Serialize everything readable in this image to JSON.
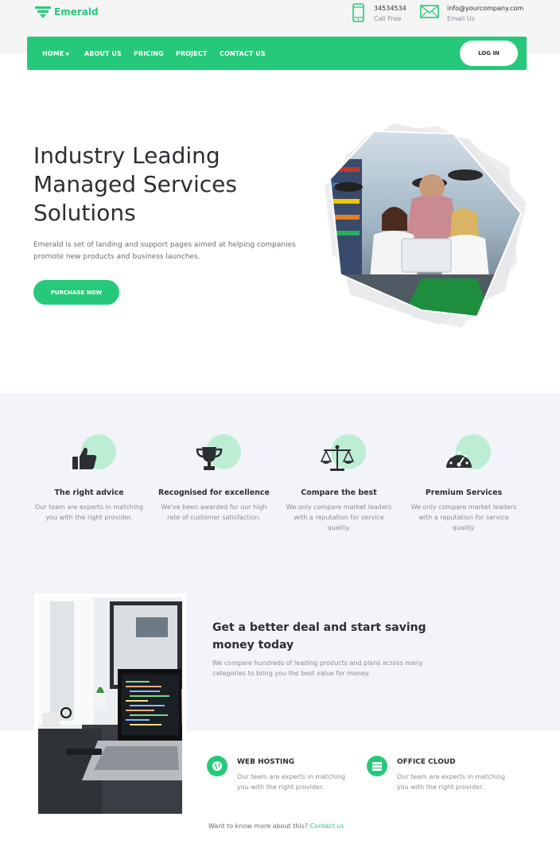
{
  "brand": {
    "name": "Emerald",
    "accent": "#26c97a"
  },
  "contact": {
    "phone": {
      "value": "34534534",
      "label": "Call Free",
      "icon": "phone-icon"
    },
    "email": {
      "value": "info@yourcompany.com",
      "label": "Email Us",
      "icon": "envelope-icon"
    }
  },
  "nav": {
    "items": [
      {
        "label": "HOME",
        "has_caret": true
      },
      {
        "label": "ABOUT US"
      },
      {
        "label": "PRICING"
      },
      {
        "label": "PROJECT"
      },
      {
        "label": "CONTACT US"
      }
    ],
    "login_label": "LOG IN"
  },
  "hero": {
    "title_lines": [
      "Industry Leading",
      "Managed Services",
      "Solutions"
    ],
    "subtitle": "Emerald is set of landing and support pages aimed at helping companies promote new products and business launches.",
    "cta_label": "PURCHASE NOW"
  },
  "features": [
    {
      "icon": "thumbs-up-icon",
      "title": "The right advice",
      "text": "Our team are experts in matching you with the right provider."
    },
    {
      "icon": "trophy-icon",
      "title": "Recognised for excellence",
      "text": "We've been awarded for our high rate of customer satisfaction."
    },
    {
      "icon": "scales-icon",
      "title": "Compare the best",
      "text": "We only compare market leaders with a reputation for service quality."
    },
    {
      "icon": "gauge-icon",
      "title": "Premium Services",
      "text": "We only compare market leaders with a reputation for service quality."
    }
  ],
  "deal": {
    "title": "Get a better deal and start saving money today",
    "text": "We compare hundreds of leading products and plans across many categories to bring you the best value for money."
  },
  "services": [
    {
      "icon": "globe-icon",
      "title": "WEB HOSTING",
      "text": "Our team are experts in matching you with the right provider."
    },
    {
      "icon": "server-icon",
      "title": "OFFICE CLOUD",
      "text": "Our team are experts in matching you with the right provider."
    }
  ],
  "footer_note": {
    "text": "Want to know more about this?",
    "link": "Contact us"
  }
}
